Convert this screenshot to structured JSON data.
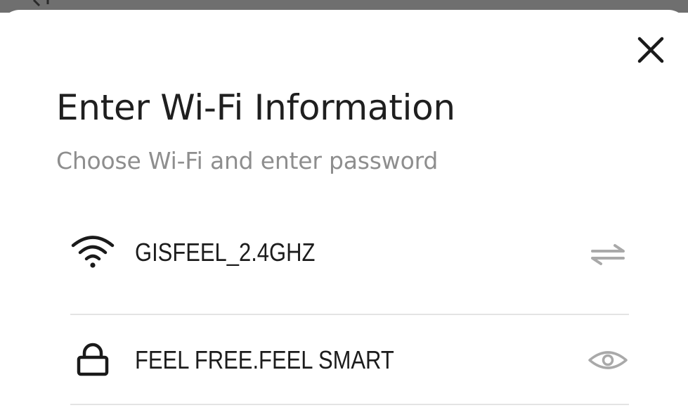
{
  "dialog": {
    "title": "Enter Wi-Fi Information",
    "subtitle": "Choose Wi-Fi and enter password",
    "close_icon": "close-icon"
  },
  "wifi_field": {
    "icon": "wifi-icon",
    "value": "GISFEEL_2.4GHZ",
    "action_icon": "switch-network-icon"
  },
  "password_field": {
    "icon": "lock-icon",
    "value": "FEEL FREE.FEEL SMART",
    "action_icon": "eye-icon"
  },
  "colors": {
    "title": "#1f1f1f",
    "subtitle": "#8e8e8e",
    "icon_muted": "#a9a9a9",
    "divider": "#e4e4e4",
    "top_bar": "#6f6f6f"
  }
}
